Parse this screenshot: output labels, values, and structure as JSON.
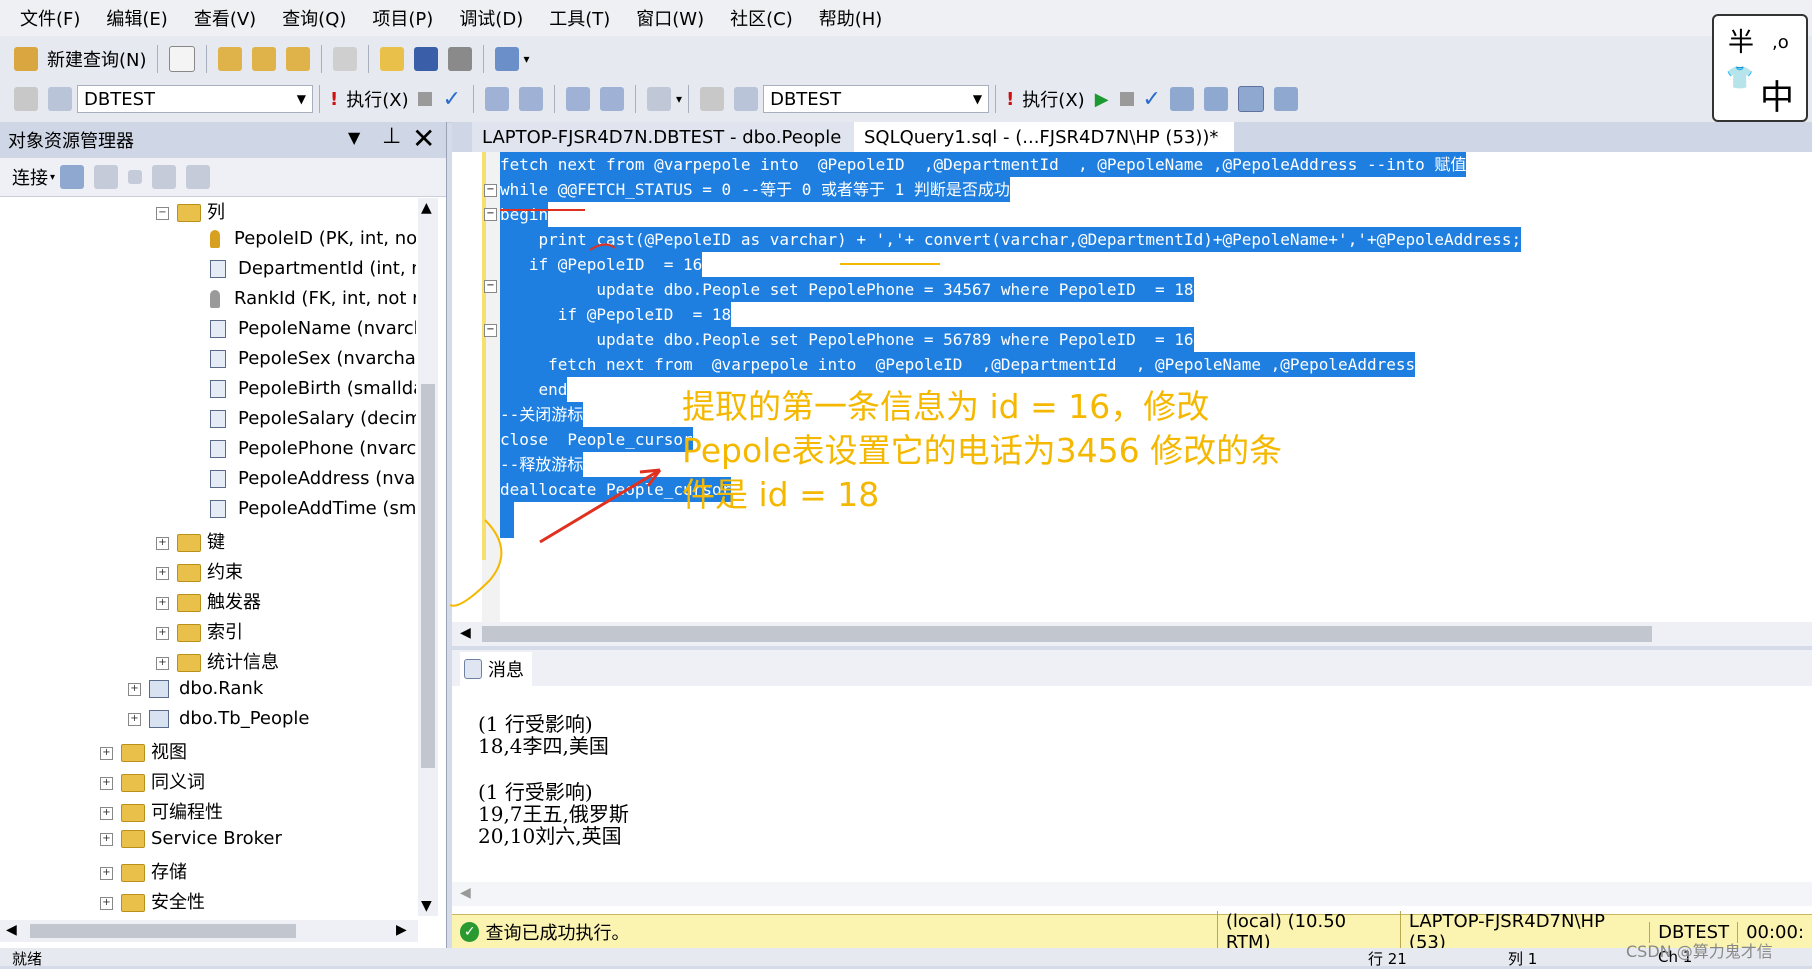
{
  "menu": [
    "文件(F)",
    "编辑(E)",
    "查看(V)",
    "查询(Q)",
    "项目(P)",
    "调试(D)",
    "工具(T)",
    "窗口(W)",
    "社区(C)",
    "帮助(H)"
  ],
  "toolbar1": {
    "new_query": "新建查询(N)"
  },
  "toolbar2": {
    "db_left": "DBTEST",
    "execute_left": "执行(X)",
    "db_right": "DBTEST",
    "execute_right": "执行(X)"
  },
  "ime": {
    "top": "半",
    "mark": ",o",
    "bottom": "中"
  },
  "explorer": {
    "title": "对象资源管理器",
    "connect": "连接",
    "items": [
      {
        "label": "列"
      },
      {
        "label": "PepoleID (PK, int, no"
      },
      {
        "label": "DepartmentId (int, n"
      },
      {
        "label": "RankId (FK, int, not r"
      },
      {
        "label": "PepoleName (nvarch"
      },
      {
        "label": "PepoleSex (nvarchar"
      },
      {
        "label": "PepoleBirth (smallda"
      },
      {
        "label": "PepoleSalary (decim"
      },
      {
        "label": "PepolePhone (nvarcl"
      },
      {
        "label": "PepoleAddress (nvai"
      },
      {
        "label": "PepoleAddTime (sm"
      },
      {
        "label": "键"
      },
      {
        "label": "约束"
      },
      {
        "label": "触发器"
      },
      {
        "label": "索引"
      },
      {
        "label": "统计信息"
      },
      {
        "label": "dbo.Rank"
      },
      {
        "label": "dbo.Tb_People"
      },
      {
        "label": "视图"
      },
      {
        "label": "同义词"
      },
      {
        "label": "可编程性"
      },
      {
        "label": "Service Broker"
      },
      {
        "label": "存储"
      },
      {
        "label": "安全性"
      }
    ]
  },
  "tabs": [
    "LAPTOP-FJSR4D7N.DBTEST - dbo.People",
    "SQLQuery1.sql - (...FJSR4D7N\\HP (53))*"
  ],
  "code": [
    "fetch next from @varpepole into  @PepoleID  ,@DepartmentId  , @PepoleName ,@PepoleAddress --into 赋值",
    "while @@FETCH_STATUS = 0 --等于 0 或者等于 1 判断是否成功",
    "begin",
    "    print cast(@PepoleID as varchar) + ','+ convert(varchar,@DepartmentId)+@PepoleName+','+@PepoleAddress;",
    "   if @PepoleID  = 16",
    "          update dbo.People set PepolePhone = 34567 where PepoleID  = 18",
    "      if @PepoleID  = 18",
    "          update dbo.People set PepolePhone = 56789 where PepoleID  = 16",
    "     fetch next from  @varpepole into  @PepoleID  ,@DepartmentId  , @PepoleName ,@PepoleAddress",
    "    end",
    "--关闭游标",
    "close  People_cursor",
    "--释放游标",
    "deallocate People_cursor"
  ],
  "annotation": [
    "提取的第一条信息为 id = 16，修改",
    "Pepole表设置它的电话为3456 修改的条",
    "件是 id = 18"
  ],
  "messages": {
    "tab": "消息",
    "lines": [
      "(1 行受影响)",
      "18,4李四,美国",
      "(1 行受影响)",
      "19,7王五,俄罗斯",
      "20,10刘六,英国"
    ]
  },
  "status": {
    "text": "查询已成功执行。",
    "server": "(local) (10.50 RTM)",
    "login": "LAPTOP-FJSR4D7N\\HP (53)",
    "db": "DBTEST",
    "time": "00:00:"
  },
  "bottom": {
    "left": "就绪",
    "row": "行 21",
    "col": "列 1",
    "ch": "Ch 1",
    "watermark": "CSDN @算力鬼才信"
  }
}
